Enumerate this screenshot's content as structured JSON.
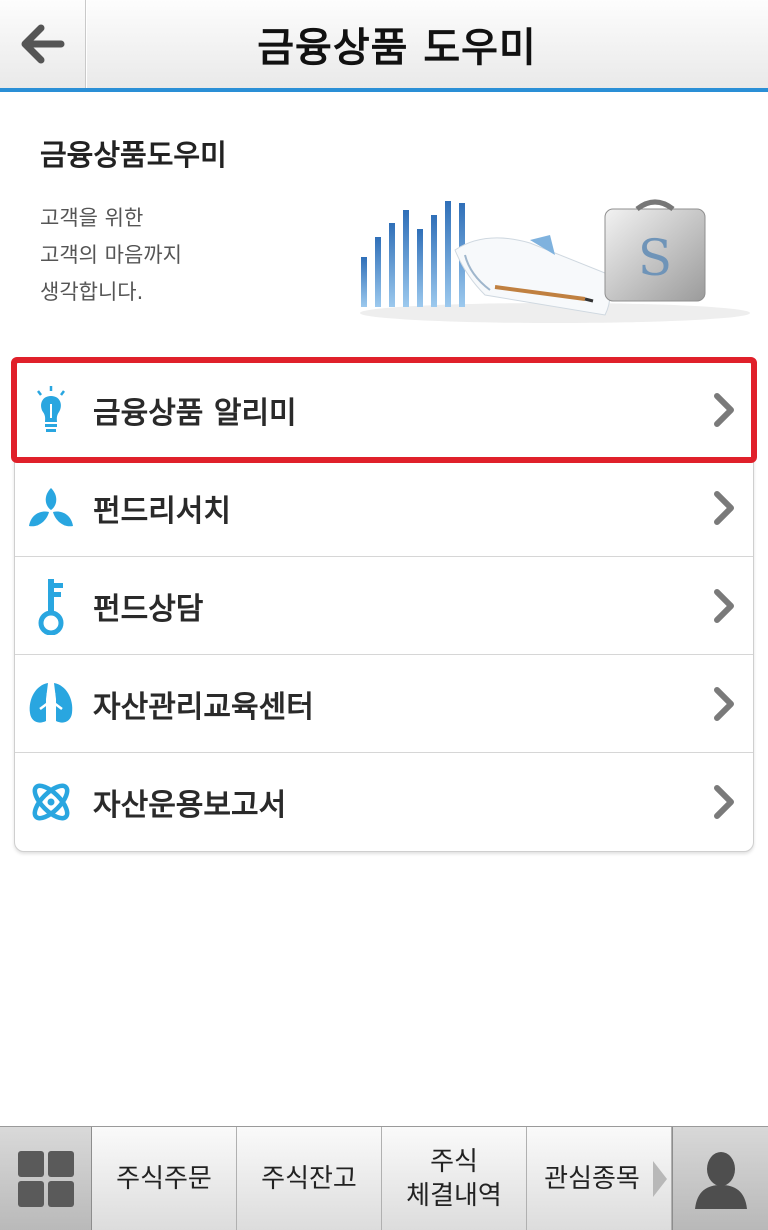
{
  "header": {
    "title": "금융상품 도우미",
    "back_icon": "arrow-left-icon"
  },
  "intro": {
    "title": "금융상품도우미",
    "lines": [
      "고객을 위한",
      "고객의 마음까지",
      "생각합니다."
    ]
  },
  "menu": {
    "items": [
      {
        "label": "금융상품 알리미",
        "icon": "lightbulb-icon",
        "highlighted": true
      },
      {
        "label": "펀드리서치",
        "icon": "leaf-trefoil-icon"
      },
      {
        "label": "펀드상담",
        "icon": "key-icon"
      },
      {
        "label": "자산관리교육센터",
        "icon": "tree-icon"
      },
      {
        "label": "자산운용보고서",
        "icon": "atom-icon"
      }
    ]
  },
  "bottom_bar": {
    "menu_icon": "grid-icon",
    "tabs": [
      {
        "label": "주식주문"
      },
      {
        "label": "주식잔고"
      },
      {
        "line1": "주식",
        "line2": "체결내역"
      },
      {
        "label": "관심종목"
      }
    ],
    "profile_icon": "user-icon"
  },
  "colors": {
    "accent": "#2a8fd6",
    "highlight_border": "#e0202a",
    "icon_blue": "#29a6e0"
  }
}
